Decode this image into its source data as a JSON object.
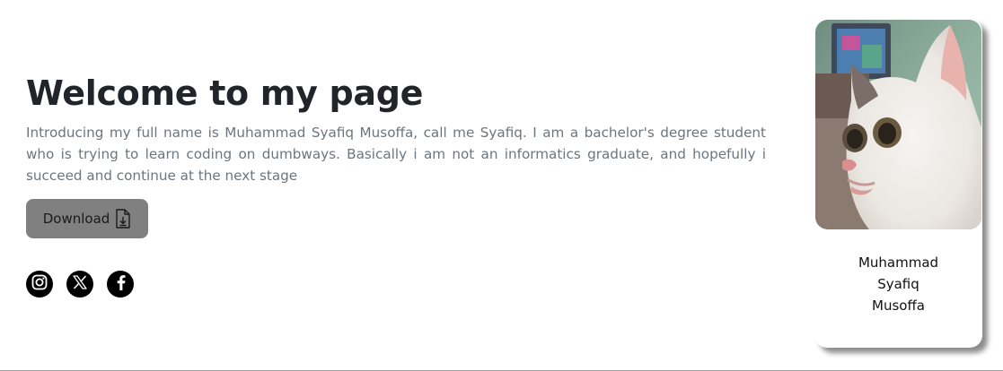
{
  "hero": {
    "title": "Welcome to my page",
    "description": "Introducing my full name is Muhammad Syafiq Musoffa, call me Syafiq. I am a bachelor's degree student who is trying to learn coding on dumbways. Basically i am not an informatics graduate, and hopefully i succeed and continue at the next stage",
    "download_label": "Download",
    "download_icon": "file-download-icon"
  },
  "socials": [
    {
      "name": "instagram",
      "icon": "instagram-icon"
    },
    {
      "name": "x",
      "icon": "x-icon"
    },
    {
      "name": "facebook",
      "icon": "facebook-icon"
    }
  ],
  "profile": {
    "name": "Muhammad Syafiq Musoffa",
    "photo": "cat-photo"
  },
  "colors": {
    "title": "#212529",
    "text": "#6c757d",
    "button": "#808080",
    "social_bg": "#000000"
  }
}
